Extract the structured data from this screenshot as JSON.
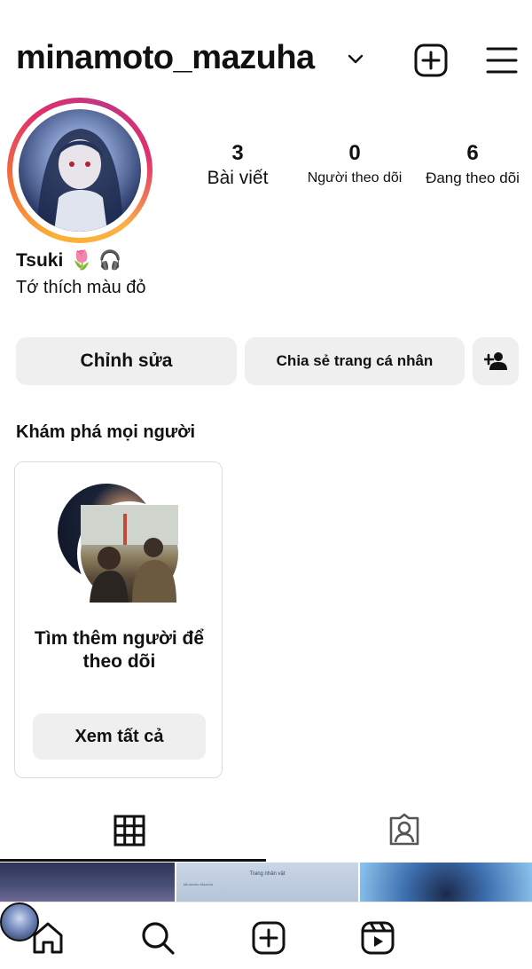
{
  "header": {
    "username": "minamoto_mazuha"
  },
  "stats": [
    {
      "value": "3",
      "label": "Bài viết"
    },
    {
      "value": "0",
      "label": "Người theo dõi"
    },
    {
      "value": "6",
      "label": "Đang theo dõi"
    }
  ],
  "profile": {
    "name": "Tsuki",
    "name_emojis": "🌷 🎧",
    "bio": "Tớ thích màu đỏ"
  },
  "actions": {
    "edit": "Chỉnh sửa",
    "share": "Chia sẻ trang cá nhân"
  },
  "discover": {
    "title": "Khám phá mọi người",
    "card_text": "Tìm thêm người để theo dõi",
    "card_button": "Xem tất cả"
  },
  "thumbnails": {
    "t2_title": "Trang nhân vật",
    "t2_sub": "Minamoto Mazuha"
  },
  "colors": {
    "ring_start": "#fbb034",
    "ring_mid": "#e1306c",
    "button_bg": "#efefef",
    "text": "#111111"
  },
  "icons": {
    "header": [
      "chevron-down-icon",
      "add-post-icon",
      "menu-icon"
    ],
    "tabs": [
      "grid-icon",
      "tagged-icon"
    ],
    "nav": [
      "home-icon",
      "search-icon",
      "create-icon",
      "reels-icon",
      "profile-avatar"
    ]
  }
}
